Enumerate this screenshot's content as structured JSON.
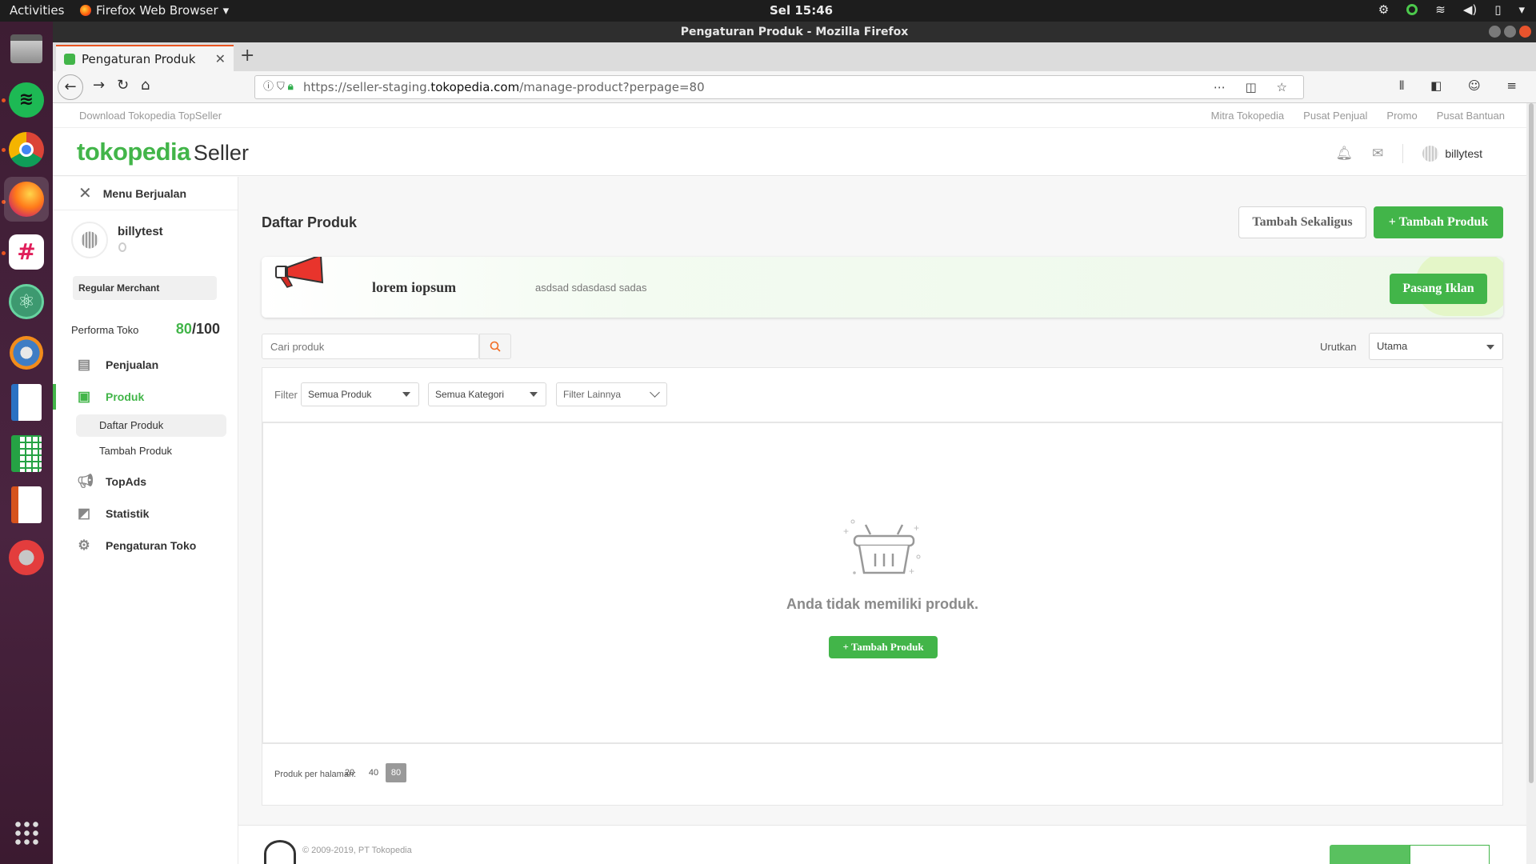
{
  "os": {
    "activities": "Activities",
    "app_menu": "Firefox Web Browser",
    "clock": "Sel 15:46"
  },
  "browser": {
    "window_title": "Pengaturan Produk - Mozilla Firefox",
    "tab_title": "Pengaturan Produk",
    "url_prefix": "https://seller-staging.",
    "url_host": "tokopedia.com",
    "url_path": "/manage-product?perpage=80"
  },
  "toplinks": {
    "download": "Download Tokopedia TopSeller",
    "links": [
      "Mitra Tokopedia",
      "Pusat Penjual",
      "Promo",
      "Pusat Bantuan"
    ]
  },
  "header": {
    "logo_main": "tokopedia",
    "logo_sub": "Seller",
    "username": "billytest"
  },
  "sidebar": {
    "menu_title": "Menu Berjualan",
    "shop_name": "billytest",
    "merchant_type": "Regular Merchant",
    "performance_label": "Performa Toko",
    "performance_score": "80",
    "performance_max": "/100",
    "items": [
      {
        "label": "Penjualan",
        "icon": "clipboard-icon"
      },
      {
        "label": "Produk",
        "icon": "box-icon",
        "active": true
      },
      {
        "label": "TopAds",
        "icon": "megaphone-icon"
      },
      {
        "label": "Statistik",
        "icon": "chart-icon"
      },
      {
        "label": "Pengaturan Toko",
        "icon": "gear-icon"
      }
    ],
    "sub_items": [
      "Daftar Produk",
      "Tambah Produk"
    ]
  },
  "main": {
    "title": "Daftar Produk",
    "bulk_add": "Tambah Sekaligus",
    "add_product": "+ Tambah Produk",
    "banner": {
      "title": "lorem iopsum",
      "desc": "asdsad sdasdasd sadas",
      "cta": "Pasang Iklan"
    },
    "search_placeholder": "Cari produk",
    "sort_label": "Urutkan",
    "sort_value": "Utama",
    "filter_label": "Filter",
    "filter_product": "Semua Produk",
    "filter_category": "Semua Kategori",
    "filter_more": "Filter Lainnya",
    "empty_message": "Anda tidak memiliki produk.",
    "empty_add": "+ Tambah Produk",
    "perpage_label": "Produk per halaman:",
    "perpage_options": [
      "20",
      "40",
      "80"
    ],
    "perpage_selected": "80"
  },
  "footer": {
    "copyright": "© 2009-2019, PT Tokopedia"
  },
  "colors": {
    "brand_green": "#42b549",
    "dock_bg": "#4a2440"
  }
}
